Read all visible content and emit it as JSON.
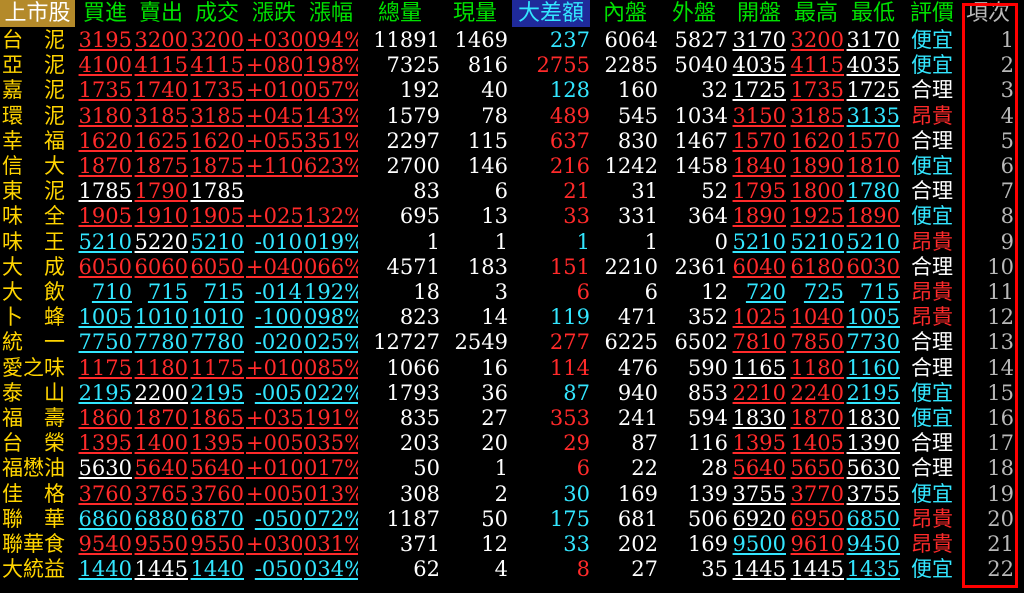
{
  "colors": {
    "background": "#000000",
    "header_green": "#00e000",
    "up_red": "#ff2a2a",
    "down_cyan": "#33e6ff",
    "flat_white": "#ffffff",
    "name_yellow": "#ffd400",
    "header_name_bg": "#b48a2a",
    "header_bigdiff_bg": "#1f2a9a",
    "highlight_frame": "#ff0000"
  },
  "header": {
    "market": "上市股",
    "columns": [
      "買進",
      "賣出",
      "成交",
      "漲跌",
      "漲幅",
      "總量",
      "現量",
      "大差額",
      "內盤",
      "外盤",
      "開盤",
      "最高",
      "最低",
      "評價",
      "項次"
    ]
  },
  "rows": [
    {
      "name": "台　泥",
      "bid": {
        "v": "3195",
        "c": "red"
      },
      "ask": {
        "v": "3200",
        "c": "red"
      },
      "last": {
        "v": "3200",
        "c": "red"
      },
      "chg": {
        "v": "+030",
        "c": "red"
      },
      "pct": {
        "v": "094%",
        "c": "red"
      },
      "vol": "11891",
      "cur": "1469",
      "diff": {
        "v": "237",
        "c": "cyan"
      },
      "inner": "6064",
      "outer": "5827",
      "open": {
        "v": "3170",
        "c": "white"
      },
      "high": {
        "v": "3200",
        "c": "red"
      },
      "low": {
        "v": "3170",
        "c": "white"
      },
      "eval": {
        "v": "便宜",
        "c": "cyan"
      },
      "idx": "1"
    },
    {
      "name": "亞　泥",
      "bid": {
        "v": "4100",
        "c": "red"
      },
      "ask": {
        "v": "4115",
        "c": "red"
      },
      "last": {
        "v": "4115",
        "c": "red"
      },
      "chg": {
        "v": "+080",
        "c": "red"
      },
      "pct": {
        "v": "198%",
        "c": "red"
      },
      "vol": "7325",
      "cur": "816",
      "diff": {
        "v": "2755",
        "c": "red"
      },
      "inner": "2285",
      "outer": "5040",
      "open": {
        "v": "4035",
        "c": "white"
      },
      "high": {
        "v": "4115",
        "c": "red"
      },
      "low": {
        "v": "4035",
        "c": "white"
      },
      "eval": {
        "v": "便宜",
        "c": "cyan"
      },
      "idx": "2"
    },
    {
      "name": "嘉　泥",
      "bid": {
        "v": "1735",
        "c": "red"
      },
      "ask": {
        "v": "1740",
        "c": "red"
      },
      "last": {
        "v": "1735",
        "c": "red"
      },
      "chg": {
        "v": "+010",
        "c": "red"
      },
      "pct": {
        "v": "057%",
        "c": "red"
      },
      "vol": "192",
      "cur": "40",
      "diff": {
        "v": "128",
        "c": "cyan"
      },
      "inner": "160",
      "outer": "32",
      "open": {
        "v": "1725",
        "c": "white"
      },
      "high": {
        "v": "1735",
        "c": "red"
      },
      "low": {
        "v": "1725",
        "c": "white"
      },
      "eval": {
        "v": "合理",
        "c": "white"
      },
      "idx": "3"
    },
    {
      "name": "環　泥",
      "bid": {
        "v": "3180",
        "c": "red"
      },
      "ask": {
        "v": "3185",
        "c": "red"
      },
      "last": {
        "v": "3185",
        "c": "red"
      },
      "chg": {
        "v": "+045",
        "c": "red"
      },
      "pct": {
        "v": "143%",
        "c": "red"
      },
      "vol": "1579",
      "cur": "78",
      "diff": {
        "v": "489",
        "c": "red"
      },
      "inner": "545",
      "outer": "1034",
      "open": {
        "v": "3150",
        "c": "red"
      },
      "high": {
        "v": "3185",
        "c": "red"
      },
      "low": {
        "v": "3135",
        "c": "cyan"
      },
      "eval": {
        "v": "昂貴",
        "c": "red"
      },
      "idx": "4"
    },
    {
      "name": "幸　福",
      "bid": {
        "v": "1620",
        "c": "red"
      },
      "ask": {
        "v": "1625",
        "c": "red"
      },
      "last": {
        "v": "1620",
        "c": "red"
      },
      "chg": {
        "v": "+055",
        "c": "red"
      },
      "pct": {
        "v": "351%",
        "c": "red"
      },
      "vol": "2297",
      "cur": "115",
      "diff": {
        "v": "637",
        "c": "red"
      },
      "inner": "830",
      "outer": "1467",
      "open": {
        "v": "1570",
        "c": "red"
      },
      "high": {
        "v": "1620",
        "c": "red"
      },
      "low": {
        "v": "1570",
        "c": "red"
      },
      "eval": {
        "v": "合理",
        "c": "white"
      },
      "idx": "5"
    },
    {
      "name": "信　大",
      "bid": {
        "v": "1870",
        "c": "red"
      },
      "ask": {
        "v": "1875",
        "c": "red"
      },
      "last": {
        "v": "1875",
        "c": "red"
      },
      "chg": {
        "v": "+110",
        "c": "red"
      },
      "pct": {
        "v": "623%",
        "c": "red"
      },
      "vol": "2700",
      "cur": "146",
      "diff": {
        "v": "216",
        "c": "red"
      },
      "inner": "1242",
      "outer": "1458",
      "open": {
        "v": "1840",
        "c": "red"
      },
      "high": {
        "v": "1890",
        "c": "red"
      },
      "low": {
        "v": "1810",
        "c": "red"
      },
      "eval": {
        "v": "便宜",
        "c": "cyan"
      },
      "idx": "6"
    },
    {
      "name": "東　泥",
      "bid": {
        "v": "1785",
        "c": "white"
      },
      "ask": {
        "v": "1790",
        "c": "red"
      },
      "last": {
        "v": "1785",
        "c": "white"
      },
      "chg": {
        "v": "",
        "c": "white"
      },
      "pct": {
        "v": "",
        "c": "white"
      },
      "vol": "83",
      "cur": "6",
      "diff": {
        "v": "21",
        "c": "red"
      },
      "inner": "31",
      "outer": "52",
      "open": {
        "v": "1795",
        "c": "red"
      },
      "high": {
        "v": "1800",
        "c": "red"
      },
      "low": {
        "v": "1780",
        "c": "cyan"
      },
      "eval": {
        "v": "合理",
        "c": "white"
      },
      "idx": "7"
    },
    {
      "name": "味　全",
      "bid": {
        "v": "1905",
        "c": "red"
      },
      "ask": {
        "v": "1910",
        "c": "red"
      },
      "last": {
        "v": "1905",
        "c": "red"
      },
      "chg": {
        "v": "+025",
        "c": "red"
      },
      "pct": {
        "v": "132%",
        "c": "red"
      },
      "vol": "695",
      "cur": "13",
      "diff": {
        "v": "33",
        "c": "red"
      },
      "inner": "331",
      "outer": "364",
      "open": {
        "v": "1890",
        "c": "red"
      },
      "high": {
        "v": "1925",
        "c": "red"
      },
      "low": {
        "v": "1890",
        "c": "red"
      },
      "eval": {
        "v": "便宜",
        "c": "cyan"
      },
      "idx": "8"
    },
    {
      "name": "味　王",
      "bid": {
        "v": "5210",
        "c": "cyan"
      },
      "ask": {
        "v": "5220",
        "c": "white"
      },
      "last": {
        "v": "5210",
        "c": "cyan"
      },
      "chg": {
        "v": "-010",
        "c": "cyan"
      },
      "pct": {
        "v": "019%",
        "c": "cyan"
      },
      "vol": "1",
      "cur": "1",
      "diff": {
        "v": "1",
        "c": "cyan"
      },
      "inner": "1",
      "outer": "0",
      "open": {
        "v": "5210",
        "c": "cyan"
      },
      "high": {
        "v": "5210",
        "c": "cyan"
      },
      "low": {
        "v": "5210",
        "c": "cyan"
      },
      "eval": {
        "v": "昂貴",
        "c": "red"
      },
      "idx": "9"
    },
    {
      "name": "大　成",
      "bid": {
        "v": "6050",
        "c": "red"
      },
      "ask": {
        "v": "6060",
        "c": "red"
      },
      "last": {
        "v": "6050",
        "c": "red"
      },
      "chg": {
        "v": "+040",
        "c": "red"
      },
      "pct": {
        "v": "066%",
        "c": "red"
      },
      "vol": "4571",
      "cur": "183",
      "diff": {
        "v": "151",
        "c": "red"
      },
      "inner": "2210",
      "outer": "2361",
      "open": {
        "v": "6040",
        "c": "red"
      },
      "high": {
        "v": "6180",
        "c": "red"
      },
      "low": {
        "v": "6030",
        "c": "red"
      },
      "eval": {
        "v": "合理",
        "c": "white"
      },
      "idx": "10"
    },
    {
      "name": "大　飲",
      "bid": {
        "v": "710",
        "c": "cyan"
      },
      "ask": {
        "v": "715",
        "c": "cyan"
      },
      "last": {
        "v": "715",
        "c": "cyan"
      },
      "chg": {
        "v": "-014",
        "c": "cyan"
      },
      "pct": {
        "v": "192%",
        "c": "cyan"
      },
      "vol": "18",
      "cur": "3",
      "diff": {
        "v": "6",
        "c": "red"
      },
      "inner": "6",
      "outer": "12",
      "open": {
        "v": "720",
        "c": "cyan"
      },
      "high": {
        "v": "725",
        "c": "cyan"
      },
      "low": {
        "v": "715",
        "c": "cyan"
      },
      "eval": {
        "v": "昂貴",
        "c": "red"
      },
      "idx": "11"
    },
    {
      "name": "卜　蜂",
      "bid": {
        "v": "1005",
        "c": "cyan"
      },
      "ask": {
        "v": "1010",
        "c": "cyan"
      },
      "last": {
        "v": "1010",
        "c": "cyan"
      },
      "chg": {
        "v": "-100",
        "c": "cyan"
      },
      "pct": {
        "v": "098%",
        "c": "cyan"
      },
      "vol": "823",
      "cur": "14",
      "diff": {
        "v": "119",
        "c": "cyan"
      },
      "inner": "471",
      "outer": "352",
      "open": {
        "v": "1025",
        "c": "red"
      },
      "high": {
        "v": "1040",
        "c": "red"
      },
      "low": {
        "v": "1005",
        "c": "cyan"
      },
      "eval": {
        "v": "昂貴",
        "c": "red"
      },
      "idx": "12"
    },
    {
      "name": "統　一",
      "bid": {
        "v": "7750",
        "c": "cyan"
      },
      "ask": {
        "v": "7780",
        "c": "cyan"
      },
      "last": {
        "v": "7780",
        "c": "cyan"
      },
      "chg": {
        "v": "-020",
        "c": "cyan"
      },
      "pct": {
        "v": "025%",
        "c": "cyan"
      },
      "vol": "12727",
      "cur": "2549",
      "diff": {
        "v": "277",
        "c": "red"
      },
      "inner": "6225",
      "outer": "6502",
      "open": {
        "v": "7810",
        "c": "red"
      },
      "high": {
        "v": "7850",
        "c": "red"
      },
      "low": {
        "v": "7730",
        "c": "cyan"
      },
      "eval": {
        "v": "合理",
        "c": "white"
      },
      "idx": "13"
    },
    {
      "name": "愛之味",
      "bid": {
        "v": "1175",
        "c": "red"
      },
      "ask": {
        "v": "1180",
        "c": "red"
      },
      "last": {
        "v": "1175",
        "c": "red"
      },
      "chg": {
        "v": "+010",
        "c": "red"
      },
      "pct": {
        "v": "085%",
        "c": "red"
      },
      "vol": "1066",
      "cur": "16",
      "diff": {
        "v": "114",
        "c": "red"
      },
      "inner": "476",
      "outer": "590",
      "open": {
        "v": "1165",
        "c": "white"
      },
      "high": {
        "v": "1180",
        "c": "red"
      },
      "low": {
        "v": "1160",
        "c": "cyan"
      },
      "eval": {
        "v": "合理",
        "c": "white"
      },
      "idx": "14"
    },
    {
      "name": "泰　山",
      "bid": {
        "v": "2195",
        "c": "cyan"
      },
      "ask": {
        "v": "2200",
        "c": "white"
      },
      "last": {
        "v": "2195",
        "c": "cyan"
      },
      "chg": {
        "v": "-005",
        "c": "cyan"
      },
      "pct": {
        "v": "022%",
        "c": "cyan"
      },
      "vol": "1793",
      "cur": "36",
      "diff": {
        "v": "87",
        "c": "cyan"
      },
      "inner": "940",
      "outer": "853",
      "open": {
        "v": "2210",
        "c": "red"
      },
      "high": {
        "v": "2240",
        "c": "red"
      },
      "low": {
        "v": "2195",
        "c": "cyan"
      },
      "eval": {
        "v": "便宜",
        "c": "cyan"
      },
      "idx": "15"
    },
    {
      "name": "福　壽",
      "bid": {
        "v": "1860",
        "c": "red"
      },
      "ask": {
        "v": "1870",
        "c": "red"
      },
      "last": {
        "v": "1865",
        "c": "red"
      },
      "chg": {
        "v": "+035",
        "c": "red"
      },
      "pct": {
        "v": "191%",
        "c": "red"
      },
      "vol": "835",
      "cur": "27",
      "diff": {
        "v": "353",
        "c": "red"
      },
      "inner": "241",
      "outer": "594",
      "open": {
        "v": "1830",
        "c": "white"
      },
      "high": {
        "v": "1870",
        "c": "red"
      },
      "low": {
        "v": "1830",
        "c": "white"
      },
      "eval": {
        "v": "便宜",
        "c": "cyan"
      },
      "idx": "16"
    },
    {
      "name": "台　榮",
      "bid": {
        "v": "1395",
        "c": "red"
      },
      "ask": {
        "v": "1400",
        "c": "red"
      },
      "last": {
        "v": "1395",
        "c": "red"
      },
      "chg": {
        "v": "+005",
        "c": "red"
      },
      "pct": {
        "v": "035%",
        "c": "red"
      },
      "vol": "203",
      "cur": "20",
      "diff": {
        "v": "29",
        "c": "red"
      },
      "inner": "87",
      "outer": "116",
      "open": {
        "v": "1395",
        "c": "red"
      },
      "high": {
        "v": "1405",
        "c": "red"
      },
      "low": {
        "v": "1390",
        "c": "white"
      },
      "eval": {
        "v": "合理",
        "c": "white"
      },
      "idx": "17"
    },
    {
      "name": "福懋油",
      "bid": {
        "v": "5630",
        "c": "white"
      },
      "ask": {
        "v": "5640",
        "c": "red"
      },
      "last": {
        "v": "5640",
        "c": "red"
      },
      "chg": {
        "v": "+010",
        "c": "red"
      },
      "pct": {
        "v": "017%",
        "c": "red"
      },
      "vol": "50",
      "cur": "1",
      "diff": {
        "v": "6",
        "c": "red"
      },
      "inner": "22",
      "outer": "28",
      "open": {
        "v": "5640",
        "c": "red"
      },
      "high": {
        "v": "5650",
        "c": "red"
      },
      "low": {
        "v": "5630",
        "c": "white"
      },
      "eval": {
        "v": "合理",
        "c": "white"
      },
      "idx": "18"
    },
    {
      "name": "佳　格",
      "bid": {
        "v": "3760",
        "c": "red"
      },
      "ask": {
        "v": "3765",
        "c": "red"
      },
      "last": {
        "v": "3760",
        "c": "red"
      },
      "chg": {
        "v": "+005",
        "c": "red"
      },
      "pct": {
        "v": "013%",
        "c": "red"
      },
      "vol": "308",
      "cur": "2",
      "diff": {
        "v": "30",
        "c": "cyan"
      },
      "inner": "169",
      "outer": "139",
      "open": {
        "v": "3755",
        "c": "white"
      },
      "high": {
        "v": "3770",
        "c": "red"
      },
      "low": {
        "v": "3755",
        "c": "white"
      },
      "eval": {
        "v": "便宜",
        "c": "cyan"
      },
      "idx": "19"
    },
    {
      "name": "聯　華",
      "bid": {
        "v": "6860",
        "c": "cyan"
      },
      "ask": {
        "v": "6880",
        "c": "cyan"
      },
      "last": {
        "v": "6870",
        "c": "cyan"
      },
      "chg": {
        "v": "-050",
        "c": "cyan"
      },
      "pct": {
        "v": "072%",
        "c": "cyan"
      },
      "vol": "1187",
      "cur": "50",
      "diff": {
        "v": "175",
        "c": "cyan"
      },
      "inner": "681",
      "outer": "506",
      "open": {
        "v": "6920",
        "c": "white"
      },
      "high": {
        "v": "6950",
        "c": "red"
      },
      "low": {
        "v": "6850",
        "c": "cyan"
      },
      "eval": {
        "v": "昂貴",
        "c": "red"
      },
      "idx": "20"
    },
    {
      "name": "聯華食",
      "bid": {
        "v": "9540",
        "c": "red"
      },
      "ask": {
        "v": "9550",
        "c": "red"
      },
      "last": {
        "v": "9550",
        "c": "red"
      },
      "chg": {
        "v": "+030",
        "c": "red"
      },
      "pct": {
        "v": "031%",
        "c": "red"
      },
      "vol": "371",
      "cur": "12",
      "diff": {
        "v": "33",
        "c": "cyan"
      },
      "inner": "202",
      "outer": "169",
      "open": {
        "v": "9500",
        "c": "cyan"
      },
      "high": {
        "v": "9610",
        "c": "red"
      },
      "low": {
        "v": "9450",
        "c": "cyan"
      },
      "eval": {
        "v": "昂貴",
        "c": "red"
      },
      "idx": "21"
    },
    {
      "name": "大統益",
      "bid": {
        "v": "1440",
        "c": "cyan"
      },
      "ask": {
        "v": "1445",
        "c": "white"
      },
      "last": {
        "v": "1440",
        "c": "cyan"
      },
      "chg": {
        "v": "-050",
        "c": "cyan"
      },
      "pct": {
        "v": "034%",
        "c": "cyan"
      },
      "vol": "62",
      "cur": "4",
      "diff": {
        "v": "8",
        "c": "red"
      },
      "inner": "27",
      "outer": "35",
      "open": {
        "v": "1445",
        "c": "white"
      },
      "high": {
        "v": "1445",
        "c": "white"
      },
      "low": {
        "v": "1435",
        "c": "cyan"
      },
      "eval": {
        "v": "便宜",
        "c": "cyan"
      },
      "idx": "22"
    }
  ]
}
